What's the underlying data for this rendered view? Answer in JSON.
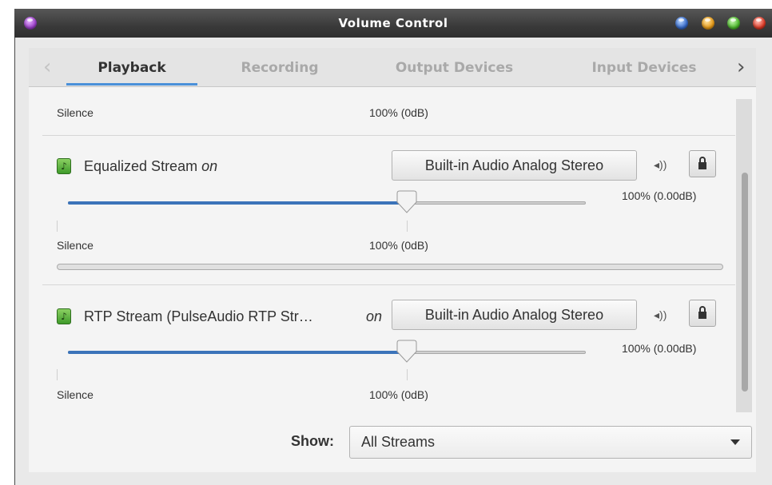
{
  "window": {
    "title": "Volume Control"
  },
  "colors": {
    "accent": "#4a90d9",
    "slider_fill": "#3b73b9",
    "app_icon": "#5cb43c"
  },
  "tabs": [
    "Playback",
    "Recording",
    "Output Devices",
    "Input Devices"
  ],
  "active_tab": "Playback",
  "top_partial": {
    "silence_label": "Silence",
    "mid_label": "100% (0dB)"
  },
  "streams": [
    {
      "icon": "music-note-icon",
      "name": "Equalized Stream",
      "state": "on",
      "device": "Built-in Audio Analog Stereo",
      "volume_readout": "100% (0.00dB)",
      "volume_fraction": 1.0,
      "silence_label": "Silence",
      "mid_label": "100% (0dB)"
    },
    {
      "icon": "music-note-icon",
      "name": "RTP Stream (PulseAudio RTP Str…",
      "state": "on",
      "device": "Built-in Audio Analog Stereo",
      "volume_readout": "100% (0.00dB)",
      "volume_fraction": 1.0,
      "silence_label": "Silence",
      "mid_label": "100% (0dB)"
    }
  ],
  "show": {
    "label": "Show:",
    "value": "All Streams"
  }
}
